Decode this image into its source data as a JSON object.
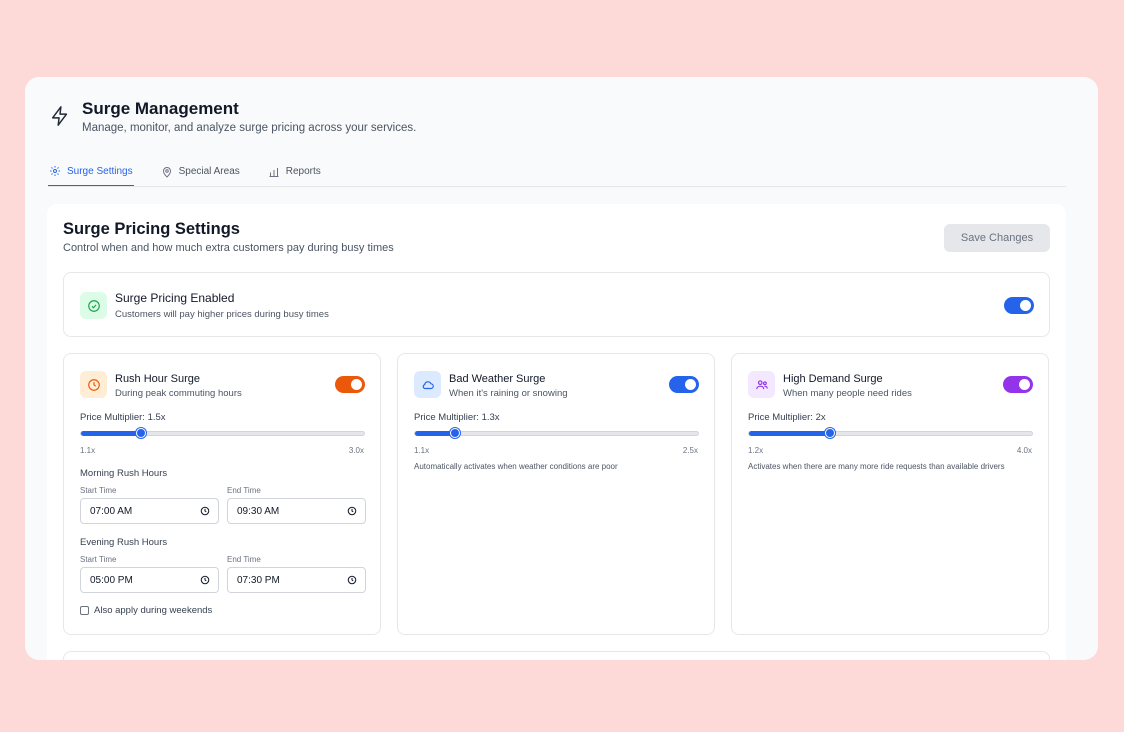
{
  "header": {
    "title": "Surge Management",
    "subtitle": "Manage, monitor, and analyze surge pricing across your services.",
    "icon": "bolt-icon"
  },
  "tabs": [
    {
      "label": "Surge Settings",
      "icon": "gear-icon",
      "active": true
    },
    {
      "label": "Special Areas",
      "icon": "map-pin-icon",
      "active": false
    },
    {
      "label": "Reports",
      "icon": "bar-chart-icon",
      "active": false
    }
  ],
  "panel": {
    "title": "Surge Pricing Settings",
    "subtitle": "Control when and how much extra customers pay during busy times",
    "save_label": "Save Changes"
  },
  "enabled": {
    "title": "Surge Pricing Enabled",
    "description": "Customers will pay higher prices during busy times",
    "on": true,
    "color": "#2563eb"
  },
  "cards": {
    "rush": {
      "title": "Rush Hour Surge",
      "description": "During peak commuting hours",
      "toggle_color": "#ea580c",
      "icon_bg": "#ffedd5",
      "multiplier_label": "Price Multiplier: 1.5x",
      "value": 1.5,
      "min": 1.1,
      "max": 3.0,
      "min_label": "1.1x",
      "max_label": "3.0x",
      "morning_label": "Morning Rush Hours",
      "evening_label": "Evening Rush Hours",
      "start_label": "Start Time",
      "end_label": "End Time",
      "morning_start": "07:00 AM",
      "morning_end": "09:30 AM",
      "evening_start": "05:00 PM",
      "evening_end": "07:30 PM",
      "weekend_label": "Also apply during weekends",
      "weekend_checked": false
    },
    "weather": {
      "title": "Bad Weather Surge",
      "description": "When it's raining or snowing",
      "toggle_color": "#2563eb",
      "icon_bg": "#dbeafe",
      "multiplier_label": "Price Multiplier: 1.3x",
      "value": 1.3,
      "min": 1.1,
      "max": 2.5,
      "min_label": "1.1x",
      "max_label": "2.5x",
      "note": "Automatically activates when weather conditions are poor"
    },
    "demand": {
      "title": "High Demand Surge",
      "description": "When many people need rides",
      "toggle_color": "#9333ea",
      "icon_bg": "#f3e8ff",
      "multiplier_label": "Price Multiplier: 2x",
      "value": 2.0,
      "min": 1.2,
      "max": 4.0,
      "min_label": "1.2x",
      "max_label": "4.0x",
      "note": "Activates when there are many more ride requests than available drivers"
    }
  }
}
